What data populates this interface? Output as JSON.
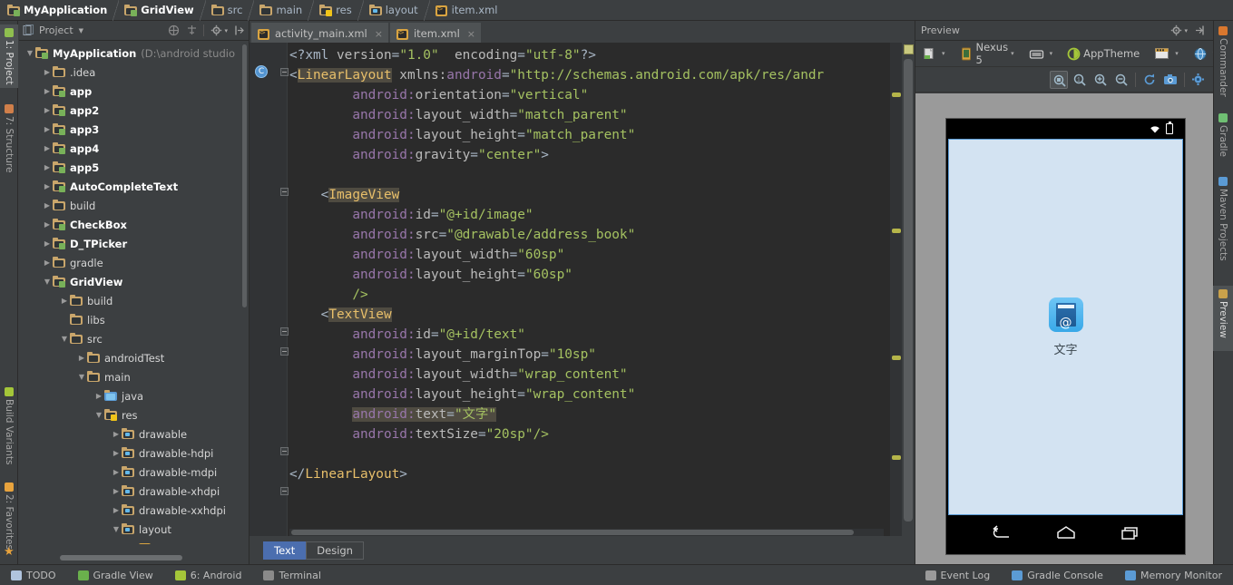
{
  "breadcrumb": [
    {
      "label": "MyApplication",
      "icon": "module-folder-icon",
      "bold": true
    },
    {
      "label": "GridView",
      "icon": "module-folder-icon",
      "bold": true
    },
    {
      "label": "src",
      "icon": "folder-icon",
      "bold": false
    },
    {
      "label": "main",
      "icon": "folder-icon",
      "bold": false
    },
    {
      "label": "res",
      "icon": "res-folder-icon",
      "bold": false
    },
    {
      "label": "layout",
      "icon": "layout-folder-icon",
      "bold": false
    },
    {
      "label": "item.xml",
      "icon": "xml-file-icon",
      "bold": false
    }
  ],
  "left_strip": [
    {
      "label": "1: Project",
      "icon": "project-icon",
      "selected": true
    },
    {
      "label": "7: Structure",
      "icon": "structure-icon",
      "selected": false
    },
    {
      "label": "Build Variants",
      "icon": "android-icon",
      "selected": false
    },
    {
      "label": "2: Favorites",
      "icon": "star-icon",
      "selected": false
    }
  ],
  "right_strip": [
    {
      "label": "Commander",
      "icon": "commander-icon",
      "selected": false
    },
    {
      "label": "Gradle",
      "icon": "gradle-icon",
      "selected": false
    },
    {
      "label": "Maven Projects",
      "icon": "maven-icon",
      "selected": false
    },
    {
      "label": "Preview",
      "icon": "preview-icon",
      "selected": true
    }
  ],
  "project_panel": {
    "title": "Project",
    "toolbar_icons": [
      "collapse-all-icon",
      "expand-all-icon",
      "settings-icon",
      "autoscroll-icon"
    ],
    "tree": [
      {
        "indent": 0,
        "arrow": "down",
        "icon": "module-folder-icon",
        "label": "MyApplication",
        "sub": "(D:\\android studio",
        "bold": true
      },
      {
        "indent": 1,
        "arrow": "right",
        "icon": "folder-icon",
        "label": ".idea",
        "bold": false
      },
      {
        "indent": 1,
        "arrow": "right",
        "icon": "module-folder-icon",
        "label": "app",
        "bold": true
      },
      {
        "indent": 1,
        "arrow": "right",
        "icon": "module-folder-icon",
        "label": "app2",
        "bold": true
      },
      {
        "indent": 1,
        "arrow": "right",
        "icon": "module-folder-icon",
        "label": "app3",
        "bold": true
      },
      {
        "indent": 1,
        "arrow": "right",
        "icon": "module-folder-icon",
        "label": "app4",
        "bold": true
      },
      {
        "indent": 1,
        "arrow": "right",
        "icon": "module-folder-icon",
        "label": "app5",
        "bold": true
      },
      {
        "indent": 1,
        "arrow": "right",
        "icon": "module-folder-icon",
        "label": "AutoCompleteText",
        "bold": true
      },
      {
        "indent": 1,
        "arrow": "right",
        "icon": "folder-icon",
        "label": "build",
        "bold": false
      },
      {
        "indent": 1,
        "arrow": "right",
        "icon": "module-folder-icon",
        "label": "CheckBox",
        "bold": true
      },
      {
        "indent": 1,
        "arrow": "right",
        "icon": "module-folder-icon",
        "label": "D_TPicker",
        "bold": true
      },
      {
        "indent": 1,
        "arrow": "right",
        "icon": "folder-icon",
        "label": "gradle",
        "bold": false
      },
      {
        "indent": 1,
        "arrow": "down",
        "icon": "module-folder-icon",
        "label": "GridView",
        "bold": true
      },
      {
        "indent": 2,
        "arrow": "right",
        "icon": "folder-icon",
        "label": "build",
        "bold": false
      },
      {
        "indent": 2,
        "arrow": "none",
        "icon": "folder-icon",
        "label": "libs",
        "bold": false
      },
      {
        "indent": 2,
        "arrow": "down",
        "icon": "folder-icon",
        "label": "src",
        "bold": false
      },
      {
        "indent": 3,
        "arrow": "right",
        "icon": "folder-icon",
        "label": "androidTest",
        "bold": false
      },
      {
        "indent": 3,
        "arrow": "down",
        "icon": "folder-icon",
        "label": "main",
        "bold": false
      },
      {
        "indent": 4,
        "arrow": "right",
        "icon": "java-folder-icon",
        "label": "java",
        "bold": false
      },
      {
        "indent": 4,
        "arrow": "down",
        "icon": "res-folder-icon",
        "label": "res",
        "bold": false
      },
      {
        "indent": 5,
        "arrow": "right",
        "icon": "layout-folder-icon",
        "label": "drawable",
        "bold": false
      },
      {
        "indent": 5,
        "arrow": "right",
        "icon": "layout-folder-icon",
        "label": "drawable-hdpi",
        "bold": false
      },
      {
        "indent": 5,
        "arrow": "right",
        "icon": "layout-folder-icon",
        "label": "drawable-mdpi",
        "bold": false
      },
      {
        "indent": 5,
        "arrow": "right",
        "icon": "layout-folder-icon",
        "label": "drawable-xhdpi",
        "bold": false
      },
      {
        "indent": 5,
        "arrow": "right",
        "icon": "layout-folder-icon",
        "label": "drawable-xxhdpi",
        "bold": false
      },
      {
        "indent": 5,
        "arrow": "down",
        "icon": "layout-folder-icon",
        "label": "layout",
        "bold": false
      },
      {
        "indent": 6,
        "arrow": "none",
        "icon": "xml-file-icon",
        "label": "activity_main.x",
        "bold": false
      }
    ]
  },
  "editor": {
    "tabs": [
      {
        "label": "activity_main.xml",
        "icon": "xml-file-icon",
        "active": false,
        "close": "×"
      },
      {
        "label": "item.xml",
        "icon": "xml-file-icon",
        "active": true,
        "close": "×"
      }
    ],
    "bottom_tabs": [
      {
        "label": "Text",
        "selected": true
      },
      {
        "label": "Design",
        "selected": false
      }
    ],
    "code_lines": [
      [
        {
          "t": "<?xml ",
          "c": "punc"
        },
        {
          "t": "version",
          "c": "attr"
        },
        {
          "t": "=",
          "c": "punc"
        },
        {
          "t": "\"1.0\"",
          "c": "val"
        },
        {
          "t": "  ",
          "c": "punc"
        },
        {
          "t": "encoding",
          "c": "attr"
        },
        {
          "t": "=",
          "c": "punc"
        },
        {
          "t": "\"utf-8\"",
          "c": "val"
        },
        {
          "t": "?>",
          "c": "punc"
        }
      ],
      [
        {
          "t": "<",
          "c": "punc"
        },
        {
          "t": "LinearLayout",
          "c": "tag-hl"
        },
        {
          "t": " xmlns:",
          "c": "attr"
        },
        {
          "t": "android",
          "c": "attrp"
        },
        {
          "t": "=",
          "c": "punc"
        },
        {
          "t": "\"http://schemas.android.com/apk/res/andr",
          "c": "val"
        }
      ],
      [
        {
          "t": "        ",
          "c": "punc"
        },
        {
          "t": "android:",
          "c": "attrp"
        },
        {
          "t": "orientation",
          "c": "attr"
        },
        {
          "t": "=",
          "c": "punc"
        },
        {
          "t": "\"vertical\"",
          "c": "val"
        }
      ],
      [
        {
          "t": "        ",
          "c": "punc"
        },
        {
          "t": "android:",
          "c": "attrp"
        },
        {
          "t": "layout_width",
          "c": "attr"
        },
        {
          "t": "=",
          "c": "punc"
        },
        {
          "t": "\"match_parent\"",
          "c": "val"
        }
      ],
      [
        {
          "t": "        ",
          "c": "punc"
        },
        {
          "t": "android:",
          "c": "attrp"
        },
        {
          "t": "layout_height",
          "c": "attr"
        },
        {
          "t": "=",
          "c": "punc"
        },
        {
          "t": "\"match_parent\"",
          "c": "val"
        }
      ],
      [
        {
          "t": "        ",
          "c": "punc"
        },
        {
          "t": "android:",
          "c": "attrp"
        },
        {
          "t": "gravity",
          "c": "attr"
        },
        {
          "t": "=",
          "c": "punc"
        },
        {
          "t": "\"center\"",
          "c": "val"
        },
        {
          "t": ">",
          "c": "punc"
        }
      ],
      [],
      [
        {
          "t": "    <",
          "c": "punc"
        },
        {
          "t": "ImageView",
          "c": "tag-hl"
        }
      ],
      [
        {
          "t": "        ",
          "c": "punc"
        },
        {
          "t": "android:",
          "c": "attrp"
        },
        {
          "t": "id",
          "c": "attr"
        },
        {
          "t": "=",
          "c": "punc"
        },
        {
          "t": "\"@+id/image\"",
          "c": "val"
        }
      ],
      [
        {
          "t": "        ",
          "c": "punc"
        },
        {
          "t": "android:",
          "c": "attrp"
        },
        {
          "t": "src",
          "c": "attr"
        },
        {
          "t": "=",
          "c": "punc"
        },
        {
          "t": "\"@drawable/address_book\"",
          "c": "val"
        }
      ],
      [
        {
          "t": "        ",
          "c": "punc"
        },
        {
          "t": "android:",
          "c": "attrp"
        },
        {
          "t": "layout_width",
          "c": "attr"
        },
        {
          "t": "=",
          "c": "punc"
        },
        {
          "t": "\"60sp\"",
          "c": "val"
        }
      ],
      [
        {
          "t": "        ",
          "c": "punc"
        },
        {
          "t": "android:",
          "c": "attrp"
        },
        {
          "t": "layout_height",
          "c": "attr"
        },
        {
          "t": "=",
          "c": "punc"
        },
        {
          "t": "\"60sp\"",
          "c": "val"
        }
      ],
      [
        {
          "t": "        ",
          "c": "punc"
        },
        {
          "t": "/>",
          "c": "val"
        }
      ],
      [
        {
          "t": "    <",
          "c": "punc"
        },
        {
          "t": "TextView",
          "c": "tag-hl"
        }
      ],
      [
        {
          "t": "        ",
          "c": "punc"
        },
        {
          "t": "android:",
          "c": "attrp"
        },
        {
          "t": "id",
          "c": "attr"
        },
        {
          "t": "=",
          "c": "punc"
        },
        {
          "t": "\"@+id/text\"",
          "c": "val"
        }
      ],
      [
        {
          "t": "        ",
          "c": "punc"
        },
        {
          "t": "android:",
          "c": "attrp"
        },
        {
          "t": "layout_marginTop",
          "c": "attr"
        },
        {
          "t": "=",
          "c": "punc"
        },
        {
          "t": "\"10sp\"",
          "c": "val"
        }
      ],
      [
        {
          "t": "        ",
          "c": "punc"
        },
        {
          "t": "android:",
          "c": "attrp"
        },
        {
          "t": "layout_width",
          "c": "attr"
        },
        {
          "t": "=",
          "c": "punc"
        },
        {
          "t": "\"wrap_content\"",
          "c": "val"
        }
      ],
      [
        {
          "t": "        ",
          "c": "punc"
        },
        {
          "t": "android:",
          "c": "attrp"
        },
        {
          "t": "layout_height",
          "c": "attr"
        },
        {
          "t": "=",
          "c": "punc"
        },
        {
          "t": "\"wrap_content\"",
          "c": "val"
        }
      ],
      [
        {
          "t": "        ",
          "c": "punc"
        },
        {
          "t": "android:",
          "c": "attrp-hl"
        },
        {
          "t": "text",
          "c": "attr-hl"
        },
        {
          "t": "=",
          "c": "punc-hl"
        },
        {
          "t": "\"文字\"",
          "c": "val-hl"
        }
      ],
      [
        {
          "t": "        ",
          "c": "punc"
        },
        {
          "t": "android:",
          "c": "attrp"
        },
        {
          "t": "textSize",
          "c": "attr"
        },
        {
          "t": "=",
          "c": "punc"
        },
        {
          "t": "\"20sp\"",
          "c": "val"
        },
        {
          "t": "/>",
          "c": "val"
        }
      ],
      [],
      [
        {
          "t": "</",
          "c": "punc"
        },
        {
          "t": "LinearLayout",
          "c": "tag"
        },
        {
          "t": ">",
          "c": "punc"
        }
      ]
    ]
  },
  "preview": {
    "title": "Preview",
    "toolbar_row1": [
      {
        "label": "",
        "icon": "layout-variant-icon",
        "caret": true
      },
      {
        "label": "Nexus 5",
        "icon": "device-icon",
        "caret": true
      },
      {
        "label": "",
        "icon": "orientation-icon",
        "caret": true
      },
      {
        "label": "AppTheme",
        "icon": "theme-icon",
        "caret": false
      },
      {
        "label": "",
        "icon": "locale-icon",
        "caret": true
      },
      {
        "label": "",
        "icon": "globe-icon",
        "caret": true
      },
      {
        "label": "»",
        "icon": "overflow-icon",
        "caret": false
      }
    ],
    "toolbar_row2": [
      {
        "icon": "zoom-fit-icon",
        "active": true
      },
      {
        "icon": "zoom-actual-icon",
        "active": false
      },
      {
        "icon": "zoom-in-icon",
        "active": false
      },
      {
        "icon": "zoom-out-icon",
        "active": false
      },
      {
        "icon": "refresh-icon",
        "active": false
      },
      {
        "icon": "screenshot-icon",
        "active": false
      },
      {
        "icon": "settings-icon",
        "active": false
      }
    ],
    "device_name": "Nexus 5",
    "app_text": "文字",
    "nav_buttons": [
      "back-icon",
      "home-icon",
      "recents-icon"
    ],
    "status_icons": [
      "wifi-icon",
      "battery-icon"
    ]
  },
  "statusbar": {
    "left": [
      {
        "label": "TODO",
        "icon": "todo-icon",
        "color": "#b0c4de"
      },
      {
        "label": "Gradle View",
        "icon": "plus-icon",
        "color": "#6ab04c"
      },
      {
        "label": "6: Android",
        "icon": "android-icon",
        "color": "#a4c639"
      },
      {
        "label": "Terminal",
        "icon": "terminal-icon",
        "color": "#8a8a8a"
      }
    ],
    "right": [
      {
        "label": "Event Log",
        "icon": "event-log-icon",
        "color": "#9a9a9a"
      },
      {
        "label": "Gradle Console",
        "icon": "gradle-console-icon",
        "color": "#5b9bd5"
      },
      {
        "label": "Memory Monitor",
        "icon": "memory-monitor-icon",
        "color": "#5b9bd5"
      }
    ]
  },
  "colors": {
    "bg": "#3c3f41",
    "editor_bg": "#2b2b2b",
    "tag": "#e8bf6a",
    "value": "#a5c261",
    "namespace": "#9876aa",
    "attr": "#bababa",
    "selection": "#4b6eaf",
    "highlight": "#4f4b41",
    "screen": "#d3e3f2",
    "screen_border": "#5a9bd5"
  }
}
